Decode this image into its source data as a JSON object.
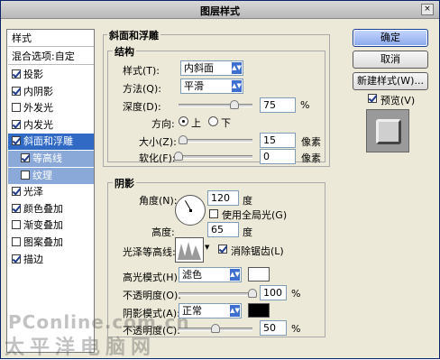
{
  "window": {
    "title": "图层样式",
    "close_glyph": "×"
  },
  "left_list": {
    "header": "样式",
    "blend": "混合选项:自定",
    "items": [
      {
        "label": "投影",
        "checked": true
      },
      {
        "label": "内阴影",
        "checked": true
      },
      {
        "label": "外发光",
        "checked": false
      },
      {
        "label": "内发光",
        "checked": true
      },
      {
        "label": "斜面和浮雕",
        "checked": true,
        "selected": true
      },
      {
        "label": "等高线",
        "checked": true,
        "sub": true
      },
      {
        "label": "纹理",
        "checked": false,
        "sub": true
      },
      {
        "label": "光泽",
        "checked": true
      },
      {
        "label": "颜色叠加",
        "checked": true
      },
      {
        "label": "渐变叠加",
        "checked": false
      },
      {
        "label": "图案叠加",
        "checked": false
      },
      {
        "label": "描边",
        "checked": true
      }
    ]
  },
  "bevel": {
    "group_title": "斜面和浮雕",
    "structure_title": "结构",
    "style_label": "样式(T):",
    "style_value": "内斜面",
    "technique_label": "方法(Q):",
    "technique_value": "平滑",
    "depth_label": "深度(D):",
    "depth_value": "75",
    "depth_unit": "%",
    "depth_level": 0.75,
    "direction_label": "方向:",
    "dir_up": "上",
    "dir_down": "下",
    "size_label": "大小(Z):",
    "size_value": "15",
    "size_unit": "像素",
    "size_level": 0.06,
    "soften_label": "软化(F):",
    "soften_value": "0",
    "soften_unit": "像素",
    "soften_level": 0.0
  },
  "shading": {
    "title": "阴影",
    "angle_label": "角度(N):",
    "angle_value": "120",
    "angle_unit": "度",
    "global_light_label": "使用全局光(G)",
    "altitude_label": "高度:",
    "altitude_value": "65",
    "altitude_unit": "度",
    "gloss_label": "光泽等高线:",
    "antialias_label": "消除锯齿(L)",
    "highlight_mode_label": "高光模式(H):",
    "highlight_mode_value": "滤色",
    "highlight_color": "#ffffff",
    "highlight_opacity_label": "不透明度(O):",
    "highlight_opacity_value": "100",
    "highlight_opacity_unit": "%",
    "highlight_opacity_level": 1.0,
    "shadow_mode_label": "阴影模式(A):",
    "shadow_mode_value": "正常",
    "shadow_color": "#000000",
    "shadow_opacity_label": "不透明度(C):",
    "shadow_opacity_value": "50",
    "shadow_opacity_unit": "%",
    "shadow_opacity_level": 0.5
  },
  "buttons": {
    "ok": "确定",
    "cancel": "取消",
    "new_style": "新建样式(W)...",
    "preview": "预览(V)"
  },
  "watermark": {
    "line1": "PConline.com.cn",
    "line2": "太平洋电脑网"
  }
}
